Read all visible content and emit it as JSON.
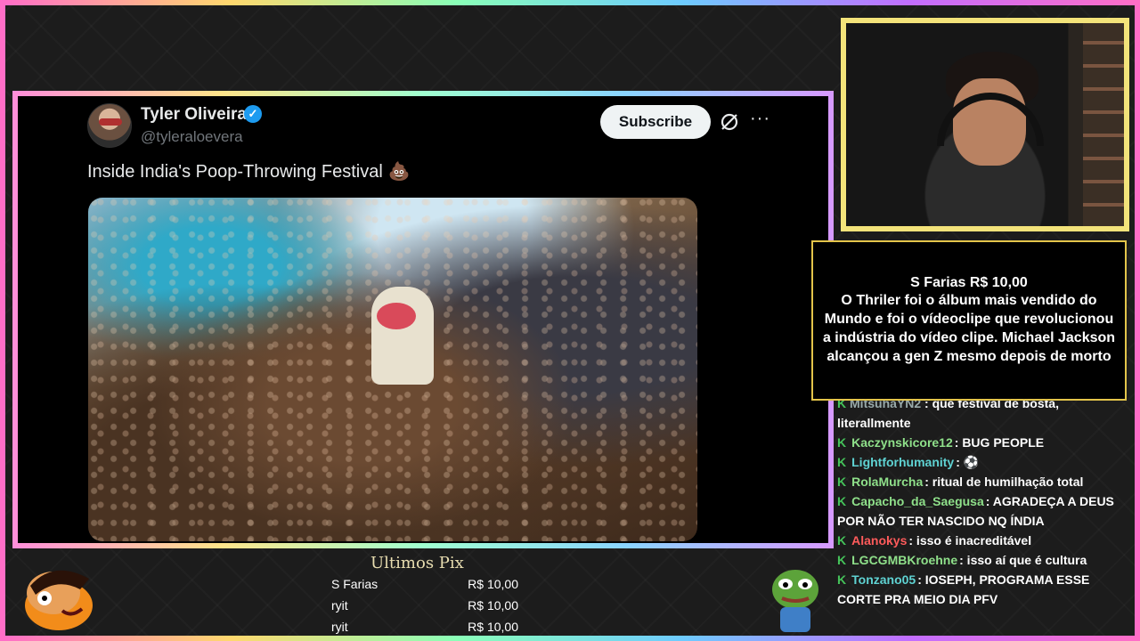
{
  "tweet": {
    "author_name": "Tyler Oliveira",
    "handle": "@tyleraloevera",
    "subscribe_label": "Subscribe",
    "text": "Inside India's Poop-Throwing Festival",
    "emoji": "💩",
    "verified_icon": "verified-badge-icon",
    "more_icon": "more-options-icon",
    "grok_icon": "grok-icon"
  },
  "alert": {
    "title": "S Farias R$ 10,00",
    "message": "O Thriler foi o álbum mais vendido do Mundo e foi o vídeoclipe que revolucionou a indústria do vídeo clipe. Michael Jackson alcançou a gen Z mesmo depois de morto"
  },
  "chat": {
    "cutoff": {
      "user": "MitsuhaYN2",
      "message": ": que festival de bosta, literallmente"
    },
    "messages": [
      {
        "user": "Kaczynskicore12",
        "color": "#8fe08a",
        "message": ": BUG PEOPLE"
      },
      {
        "user": "Lightforhumanity",
        "color": "#5fd3d3",
        "message": ": ⚽"
      },
      {
        "user": "RolaMurcha",
        "color": "#8fe08a",
        "message": ": ritual de humilhação total"
      },
      {
        "user": "Capacho_da_Saegusa",
        "color": "#8fe08a",
        "message": ": AGRADEÇA A DEUS POR NÃO TER NASCIDO NQ ÍNDIA"
      },
      {
        "user": "Alanokys",
        "color": "#ff5b5b",
        "message": ": isso é inacreditável"
      },
      {
        "user": "LGCGMBKroehne",
        "color": "#8fe08a",
        "message": ": isso aí que é cultura"
      },
      {
        "user": "Tonzano05",
        "color": "#5fd3d3",
        "message": ": IOSEPH, PROGRAMA ESSE CORTE PRA MEIO DIA PFV"
      }
    ]
  },
  "last_pix": {
    "title": "Ultimos Pix",
    "entries": [
      {
        "name": "S Farias",
        "amount": "R$ 10,00"
      },
      {
        "name": "ryit",
        "amount": "R$ 10,00"
      },
      {
        "name": "ryit",
        "amount": "R$ 10,00"
      }
    ]
  },
  "colors": {
    "accent_yellow": "#f3e37a",
    "chat_badge_green": "#45c35a",
    "subscribe_bg": "#eff3f4",
    "verified_blue": "#1d9bf0"
  }
}
